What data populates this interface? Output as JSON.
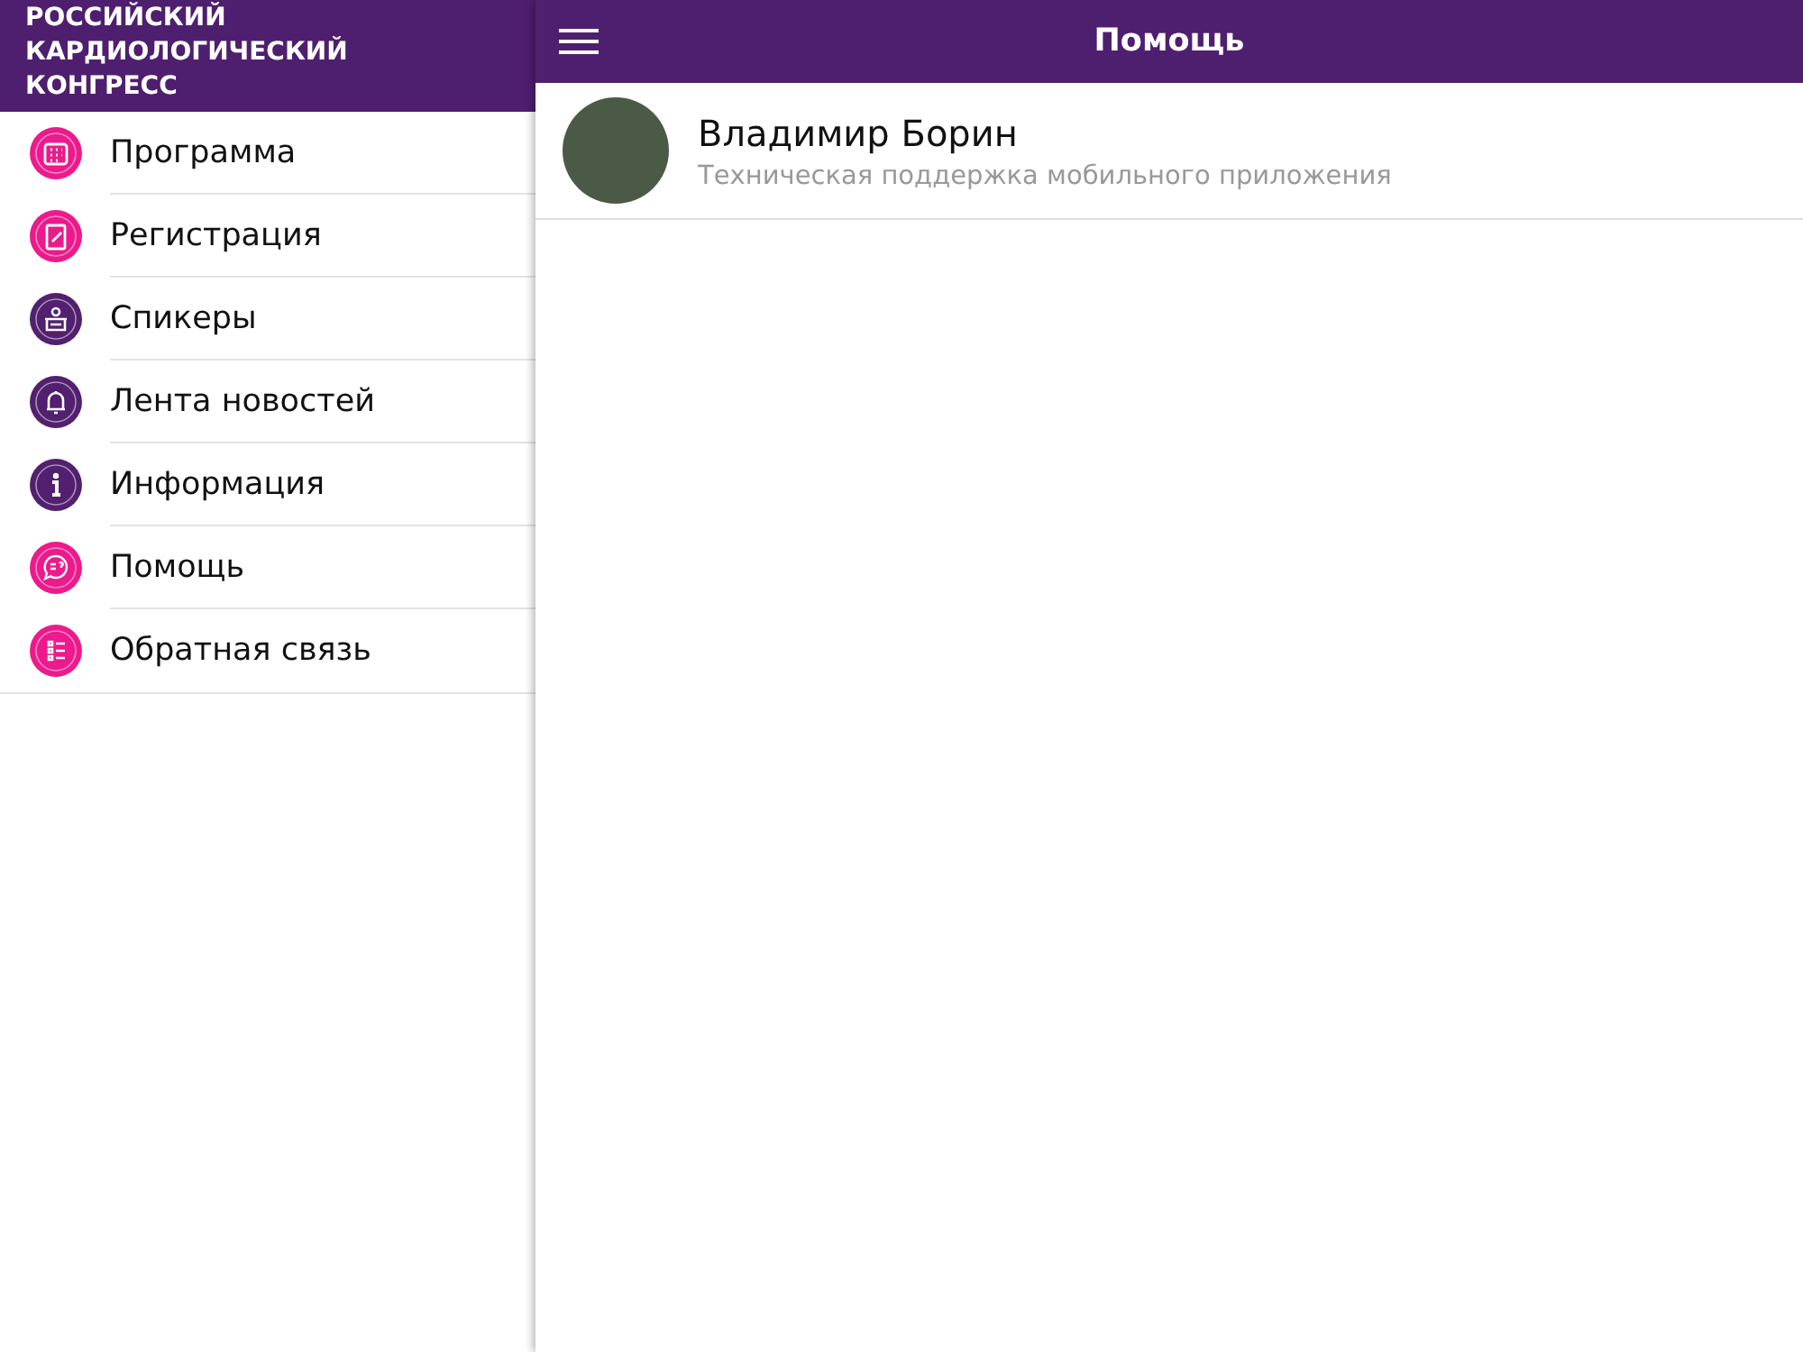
{
  "sidebar": {
    "title": "РОССИЙСКИЙ КАРДИОЛОГИЧЕСКИЙ КОНГРЕСС",
    "items": [
      {
        "label": "Программа",
        "kind": "calendar",
        "color": "#ec1a8c"
      },
      {
        "label": "Регистрация",
        "kind": "document",
        "color": "#ec1a8c"
      },
      {
        "label": "Спикеры",
        "kind": "speaker",
        "color": "#52206f"
      },
      {
        "label": "Лента новостей",
        "kind": "bell",
        "color": "#52206f"
      },
      {
        "label": "Информация",
        "kind": "info",
        "color": "#52206f"
      },
      {
        "label": "Помощь",
        "kind": "chat",
        "color": "#ec1a8c"
      },
      {
        "label": "Обратная связь",
        "kind": "list",
        "color": "#ec1a8c"
      }
    ]
  },
  "header": {
    "title": "Помощь"
  },
  "contacts": [
    {
      "name": "Владимир Борин",
      "role": "Техническая поддержка мобильного приложения"
    }
  ]
}
